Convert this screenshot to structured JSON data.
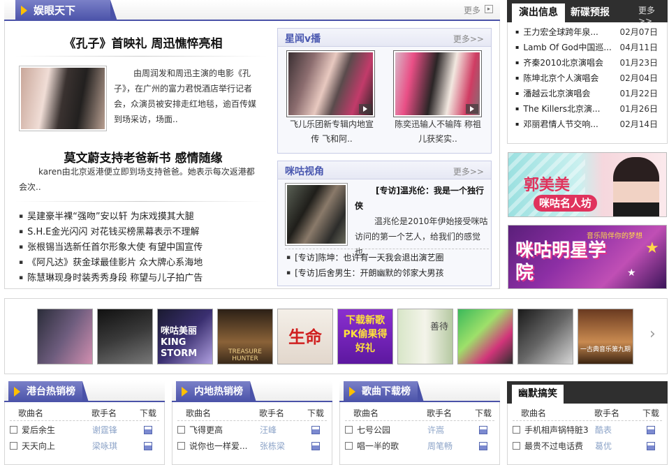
{
  "ent": {
    "title": "娱眼天下",
    "more": "更多",
    "headline1": "《孔子》首映礼 周迅憔悴亮相",
    "story1": "由周润发和周迅主演的电影《孔子》，在广州的富力君悦酒店举行记者会，众演员被安排走红地毯，逾百传媒到场采访，场面..",
    "headline2": "莫文蔚支持老爸新书 感情随缘",
    "story2": "karen由北京返港便立即到场支持爸爸。她表示每次返港都会次..",
    "news": [
      "吴建豪半裸“强吻”安以轩 为床戏摸其大腿",
      "S.H.E金光闪闪 对花钱买榜黑幕表示不理解",
      "张根锡当选新任首尔形象大使 有望中国宣传",
      "《阿凡达》获金球最佳影片 众大牌心系海地",
      "陈慧琳现身时装秀秀身段 称望与儿子拍广告"
    ]
  },
  "star": {
    "title": "星闻v播",
    "more": "更多>>",
    "items": [
      {
        "caption": "飞儿乐团新专辑内地宣传 飞和阿.."
      },
      {
        "caption": "陈奕迅输人不输阵 称祖儿获奖实.."
      }
    ]
  },
  "mi": {
    "title": "咪咕视角",
    "more": "更多>>",
    "feature_title": "[专访]温兆伦：我是一个独行侠",
    "feature_text": "温兆伦是2010年伊始接受咪咕访问的第一个艺人，给我们的感觉也..",
    "links": [
      "[专访]陈坤：也许有一天我会退出演艺圈",
      "[专访]后舍男生：开朗幽默的邻家大男孩"
    ]
  },
  "shows": {
    "tab1": "演出信息",
    "tab2": "新碟预报",
    "more": "更多>>",
    "items": [
      {
        "name": "王力宏全球跨年泉...",
        "date": "02月07日"
      },
      {
        "name": "Lamb Of God中国巡...",
        "date": "04月11日"
      },
      {
        "name": "齐秦2010北京演唱会",
        "date": "01月23日"
      },
      {
        "name": "陈坤北京个人演唱会",
        "date": "02月04日"
      },
      {
        "name": "潘越云北京演唱会",
        "date": "01月22日"
      },
      {
        "name": "The Killers北京演...",
        "date": "01月26日"
      },
      {
        "name": "邓丽君情人节交响...",
        "date": "02月14日"
      }
    ]
  },
  "banners": {
    "b1_name": "郭美美",
    "b1_sub": "咪咕名人坊",
    "b2_title": "咪咕明星学院",
    "b2_tag": "音乐陪伴你的梦想"
  },
  "albums": [
    {
      "label": ""
    },
    {
      "label": ""
    },
    {
      "label": "咪咕美丽 KING STORM"
    },
    {
      "label": "TREASURE HUNTER"
    },
    {
      "label": "生命"
    },
    {
      "label": "下载新歌 PK偷果得好礼"
    },
    {
      "label": "善待"
    },
    {
      "label": ""
    },
    {
      "label": ""
    },
    {
      "label": "一古典音乐第九期"
    }
  ],
  "ranks": [
    {
      "title": "港台热销榜",
      "cols": [
        "歌曲名",
        "歌手名",
        "下载"
      ],
      "rows": [
        {
          "song": "爱后余生",
          "artist": "谢霆锋"
        },
        {
          "song": "天天向上",
          "artist": "梁咏琪"
        }
      ]
    },
    {
      "title": "内地热销榜",
      "cols": [
        "歌曲名",
        "歌手名",
        "下载"
      ],
      "rows": [
        {
          "song": "飞得更高",
          "artist": "汪峰"
        },
        {
          "song": "说你也一样爱...",
          "artist": "张栋梁"
        }
      ]
    },
    {
      "title": "歌曲下载榜",
      "cols": [
        "歌曲名",
        "歌手名",
        "下载"
      ],
      "rows": [
        {
          "song": "七号公园",
          "artist": "许嵩"
        },
        {
          "song": "唱一半的歌",
          "artist": "周笔畅"
        }
      ]
    },
    {
      "title": "幽默搞笑",
      "cols": [
        "歌曲名",
        "歌手名",
        "下载"
      ],
      "rows": [
        {
          "song": "手机相声锅特脏3",
          "artist": "酷表"
        },
        {
          "song": "最贵不过电话费",
          "artist": "葛优"
        }
      ]
    }
  ]
}
